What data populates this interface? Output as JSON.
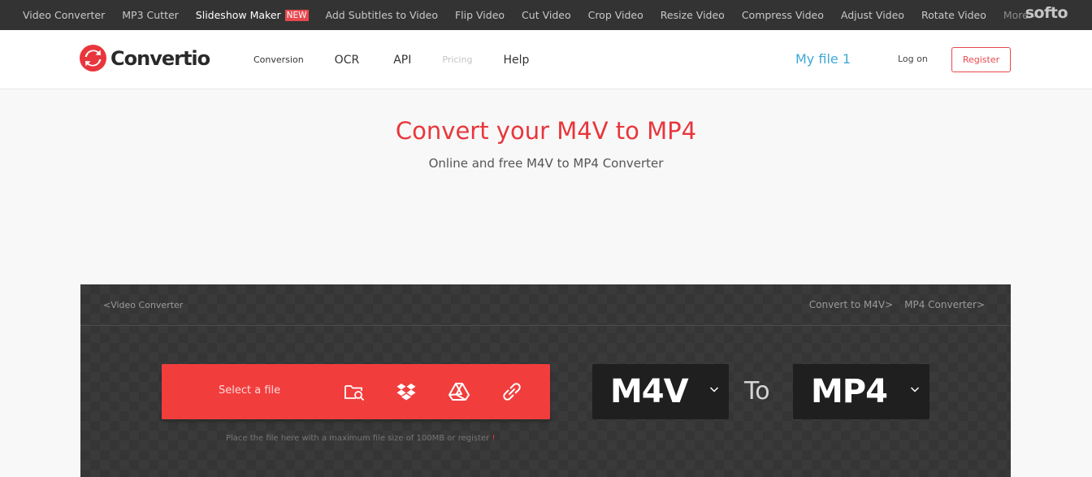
{
  "topbar": {
    "links": [
      {
        "label": "Video Converter"
      },
      {
        "label": "MP3 Cutter"
      },
      {
        "label": "Slideshow Maker",
        "badge": "NEW",
        "active": true
      },
      {
        "label": "Add Subtitles to Video"
      },
      {
        "label": "Flip Video"
      },
      {
        "label": "Cut Video"
      },
      {
        "label": "Crop Video"
      },
      {
        "label": "Resize Video"
      },
      {
        "label": "Compress Video"
      },
      {
        "label": "Adjust Video"
      },
      {
        "label": "Rotate Video"
      }
    ],
    "more_label": "More",
    "brand": "softo"
  },
  "header": {
    "logo_text": "Convertio",
    "nav": {
      "conversion": "Conversion",
      "ocr": "OCR",
      "api": "API",
      "pricing": "Pricing",
      "help": "Help"
    },
    "my_files": "My file 1",
    "login": "Log on",
    "register": "Register"
  },
  "hero": {
    "title": "Convert your M4V to MP4",
    "subtitle": "Online and free M4V to MP4 Converter"
  },
  "converter": {
    "breadcrumb_left": "<Video Converter",
    "breadcrumb_right_1": "Convert to M4V>",
    "breadcrumb_right_2": "MP4 Converter>",
    "select_label": "Select a file",
    "hint": "Place the file here with a maximum file size of 100MB or register",
    "hint_mark": "!",
    "from_format": "M4V",
    "to_label": "To",
    "to_format": "MP4"
  },
  "colors": {
    "brand_red": "#e8363c",
    "select_red": "#f23d3d",
    "link_blue": "#3ea7d6",
    "topbar_bg": "#333333",
    "panel_bg": "#3a3a3a"
  }
}
